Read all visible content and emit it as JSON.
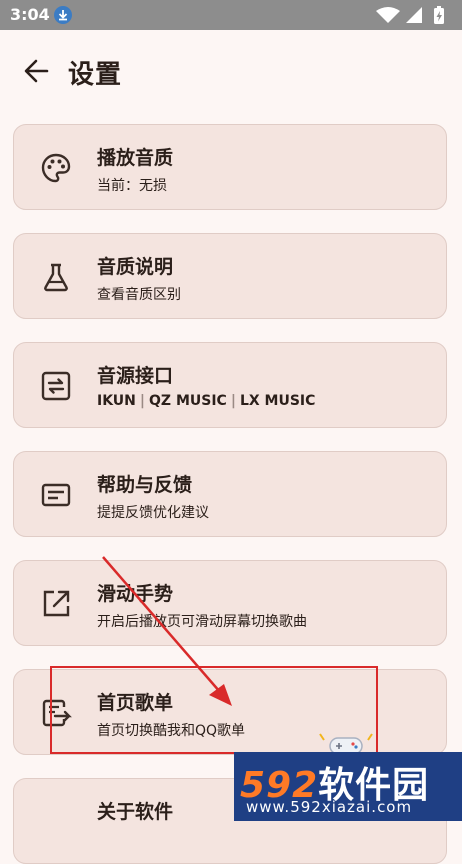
{
  "status_bar": {
    "time": "3:04",
    "icons": [
      "download-icon",
      "wifi-icon",
      "signal-icon",
      "battery-icon"
    ]
  },
  "header": {
    "title": "设置"
  },
  "settings": [
    {
      "title": "播放音质",
      "subtitle": "当前：无损",
      "icon": "palette-icon"
    },
    {
      "title": "音质说明",
      "subtitle": "查看音质区别",
      "icon": "flask-icon"
    },
    {
      "title": "音源接口",
      "subtitle_parts": [
        "IKUN",
        "QZ MUSIC",
        "LX MUSIC"
      ],
      "subtitle_separator": "|",
      "icon": "swap-icon"
    },
    {
      "title": "帮助与反馈",
      "subtitle": "提提反馈优化建议",
      "icon": "feedback-icon"
    },
    {
      "title": "滑动手势",
      "subtitle": "开启后播放页可滑动屏幕切换歌曲",
      "icon": "open-external-icon"
    },
    {
      "title": "首页歌单",
      "subtitle": "首页切换酷我和QQ歌单",
      "icon": "playlist-switch-icon"
    },
    {
      "title": "关于软件",
      "subtitle": "",
      "icon": ""
    }
  ],
  "watermark": {
    "number": "592",
    "text": "软件园",
    "url": "www.592xiazai.com"
  },
  "colors": {
    "background": "#fdf6f4",
    "card": "#f4e4df",
    "annotation_red": "#d92a2a",
    "watermark_blue": "#1f3f84",
    "watermark_orange": "#ff7a26"
  }
}
